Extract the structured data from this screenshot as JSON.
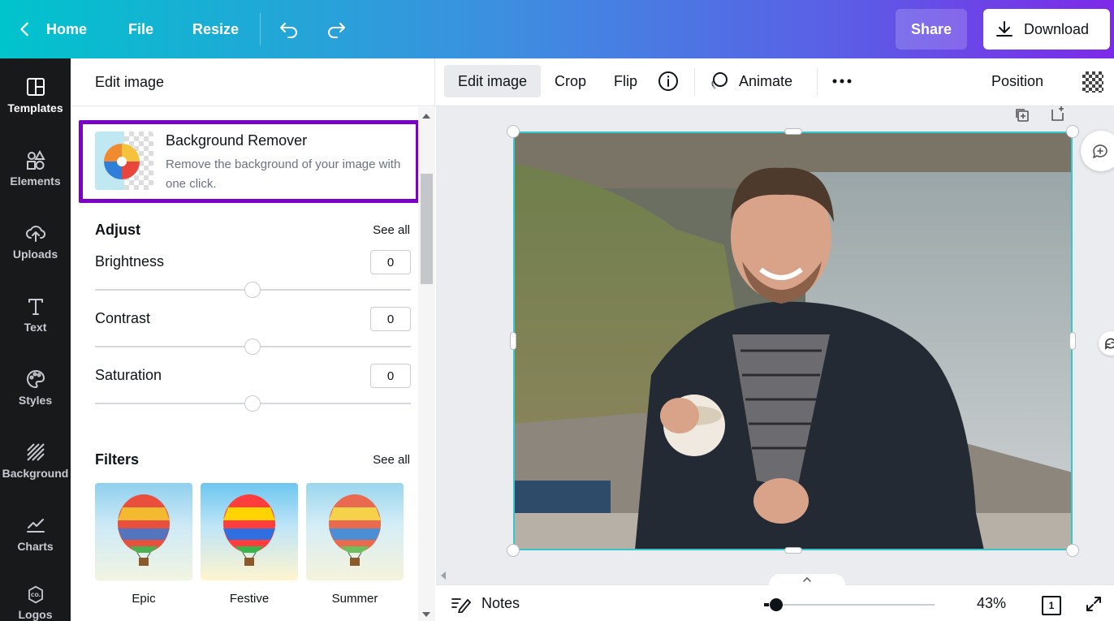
{
  "topbar": {
    "home_label": "Home",
    "file_label": "File",
    "resize_label": "Resize",
    "share_label": "Share",
    "download_label": "Download",
    "icons": [
      "chevron-left-icon",
      "undo-icon",
      "redo-icon",
      "download-icon"
    ]
  },
  "rail": {
    "items": [
      {
        "label": "Templates",
        "icon": "templates-icon",
        "active": true
      },
      {
        "label": "Elements",
        "icon": "elements-icon"
      },
      {
        "label": "Uploads",
        "icon": "upload-cloud-icon"
      },
      {
        "label": "Text",
        "icon": "text-icon"
      },
      {
        "label": "Styles",
        "icon": "palette-icon"
      },
      {
        "label": "Background",
        "icon": "background-hatch-icon"
      },
      {
        "label": "Charts",
        "icon": "chart-line-icon"
      },
      {
        "label": "Logos",
        "icon": "logo-badge-icon"
      }
    ]
  },
  "panel": {
    "header_title": "Edit image",
    "bg_remover": {
      "title": "Background Remover",
      "description": "Remove the background of your image with one click."
    },
    "adjust": {
      "title": "Adjust",
      "see_all": "See all",
      "sliders": [
        {
          "label": "Brightness",
          "value": "0",
          "position": 0.5
        },
        {
          "label": "Contrast",
          "value": "0",
          "position": 0.5
        },
        {
          "label": "Saturation",
          "value": "0",
          "position": 0.5
        }
      ]
    },
    "filters": {
      "title": "Filters",
      "see_all": "See all",
      "items": [
        {
          "label": "Epic"
        },
        {
          "label": "Festive"
        },
        {
          "label": "Summer"
        }
      ]
    }
  },
  "context_toolbar": {
    "edit_image": "Edit image",
    "crop": "Crop",
    "flip": "Flip",
    "animate": "Animate",
    "position": "Position",
    "icons": [
      "info-icon",
      "animate-icon",
      "more-icon",
      "transparency-icon"
    ]
  },
  "colors": {
    "selection": "#38c8c9",
    "highlight": "#7d00c7",
    "rail_bg": "#18191b"
  },
  "bottombar": {
    "notes_label": "Notes",
    "zoom_label": "43%",
    "zoom_fraction": 0.43,
    "page_number": "1"
  }
}
